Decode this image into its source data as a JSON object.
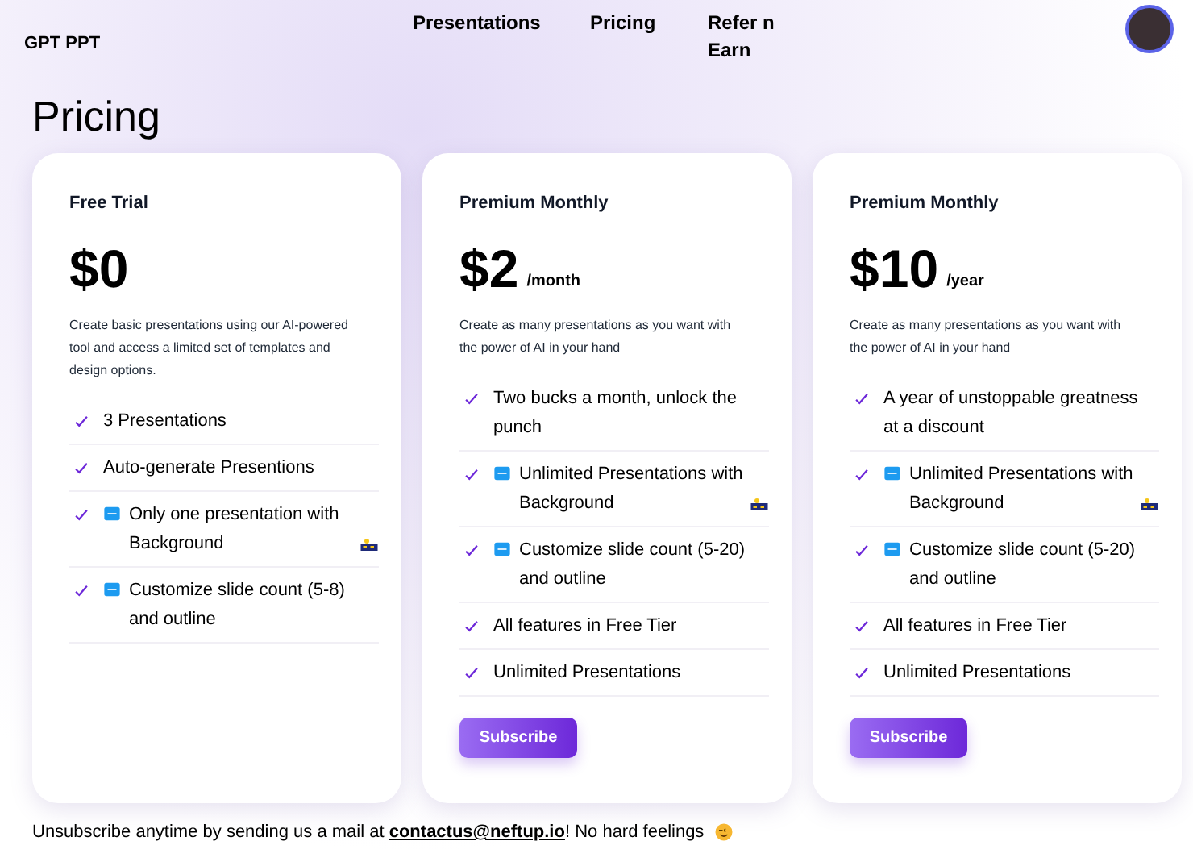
{
  "brand": "GPT PPT",
  "nav": [
    {
      "label": "Presentations"
    },
    {
      "label": "Pricing"
    },
    {
      "label": "Refer n Earn"
    }
  ],
  "heading": "Pricing",
  "plans": [
    {
      "name": "Free Trial",
      "price": "$0",
      "description": "Create basic presentations using our AI-powered tool and access a limited set of templates and design options.",
      "features": [
        {
          "kind": "plain",
          "text": "3 Presentations"
        },
        {
          "kind": "plain",
          "text": "Auto-generate Presentions"
        },
        {
          "kind": "new-image",
          "text": "Only one presentation with Background"
        },
        {
          "kind": "new",
          "text": "Customize slide count (5-8) and outline"
        }
      ]
    },
    {
      "name": "Premium Monthly",
      "price": "$2",
      "period": "/month",
      "description": "Create as many presentations as you want with the power of AI in your hand",
      "features": [
        {
          "kind": "plain",
          "text": "Two bucks a month, unlock the punch"
        },
        {
          "kind": "new-image",
          "text": "Unlimited Presentations with Background"
        },
        {
          "kind": "new",
          "text": "Customize slide count (5-20) and outline"
        },
        {
          "kind": "plain",
          "text": "All features in Free Tier"
        },
        {
          "kind": "plain",
          "text": "Unlimited Presentations"
        }
      ],
      "button": "Subscribe"
    },
    {
      "name": "Premium Monthly",
      "price": "$10",
      "period": "/year",
      "description": "Create as many presentations as you want with the power of AI in your hand",
      "features": [
        {
          "kind": "plain",
          "text": "A year of unstoppable greatness at a discount"
        },
        {
          "kind": "new-image",
          "text": "Unlimited Presentations with Background"
        },
        {
          "kind": "new",
          "text": "Customize slide count (5-20) and outline"
        },
        {
          "kind": "plain",
          "text": "All features in Free Tier"
        },
        {
          "kind": "plain",
          "text": "Unlimited Presentations"
        }
      ],
      "button": "Subscribe"
    }
  ],
  "footer": {
    "before": "Unsubscribe anytime by sending us a mail at ",
    "link": "contactus@neftup.io",
    "after": "! No hard feelings"
  }
}
